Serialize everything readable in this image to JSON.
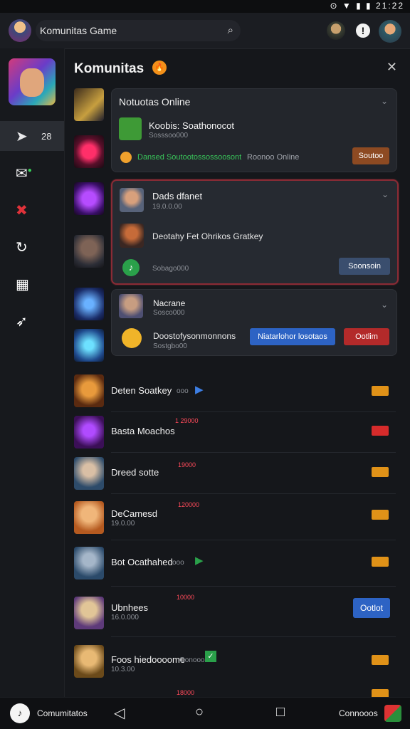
{
  "status_bar": {
    "time": "21:22"
  },
  "top_bar": {
    "app_title": "Komunitas Game"
  },
  "panel": {
    "title": "Komunitas",
    "badge": "🔥"
  },
  "sidebar": {
    "items": [
      {
        "icon": "mouse-icon",
        "count": "28"
      },
      {
        "icon": "chat-icon",
        "count": ""
      },
      {
        "icon": "sword-icon",
        "count": ""
      },
      {
        "icon": "refresh-icon",
        "count": ""
      },
      {
        "icon": "calendar-icon",
        "count": ""
      },
      {
        "icon": "rocket-icon",
        "count": ""
      }
    ]
  },
  "cards": {
    "card1": {
      "header": "Notuotas Online",
      "name": "Koobis: Soathonocot",
      "sub": "Sosssoo000",
      "status": "Dansed Soutootossossoosont",
      "status_suffix": "Roonoo Online",
      "action": "Soutoo"
    },
    "card2": {
      "name": "Dads dfanet",
      "sub": "19.0.0.00",
      "message": "Deotahy Fet Ohrikos Gratkey",
      "footer": "Sobago000",
      "action": "Soonsoin"
    },
    "card3": {
      "name": "Nacrane",
      "sub": "Sosco000",
      "message": "Doostofysonmonnons",
      "sub2": "Sostgbo00",
      "primary": "Niatarlohor losotaos",
      "danger": "Ootlim"
    }
  },
  "list": [
    {
      "name": "Deten Soatkey",
      "suffix": "ooo",
      "sub": "",
      "tag": "",
      "tag_color": "#e09218"
    },
    {
      "name": "Basta Moachos",
      "suffix": "",
      "sub": "",
      "tag": "1 29000",
      "tag_color": "#d62b2b"
    },
    {
      "name": "Dreed sotte",
      "suffix": "",
      "sub": "",
      "tag": "19000",
      "tag_color": "#e09218"
    },
    {
      "name": "DeCamesd",
      "suffix": "",
      "sub": "19.0.00",
      "tag": "120000",
      "tag_color": "#e09218"
    },
    {
      "name": "Bot Ocathahed",
      "suffix": "ooo",
      "sub": "",
      "tag": "",
      "tag_color": "#e09218"
    },
    {
      "name": "Ubnhees",
      "suffix": "",
      "sub": "16.0.000",
      "tag": "10000",
      "tag_color": "#3d7ee3",
      "action": "Ootlot"
    },
    {
      "name": "Foos hiedoooome",
      "suffix": "Oonooo",
      "sub": "10.3.00",
      "tag": "",
      "tag_color": "#e09218"
    },
    {
      "name": "",
      "suffix": "",
      "sub": "",
      "tag": "18000",
      "tag_color": "#e09218"
    }
  ],
  "nav": {
    "left": "Comumitatos",
    "right": "Connooos"
  }
}
